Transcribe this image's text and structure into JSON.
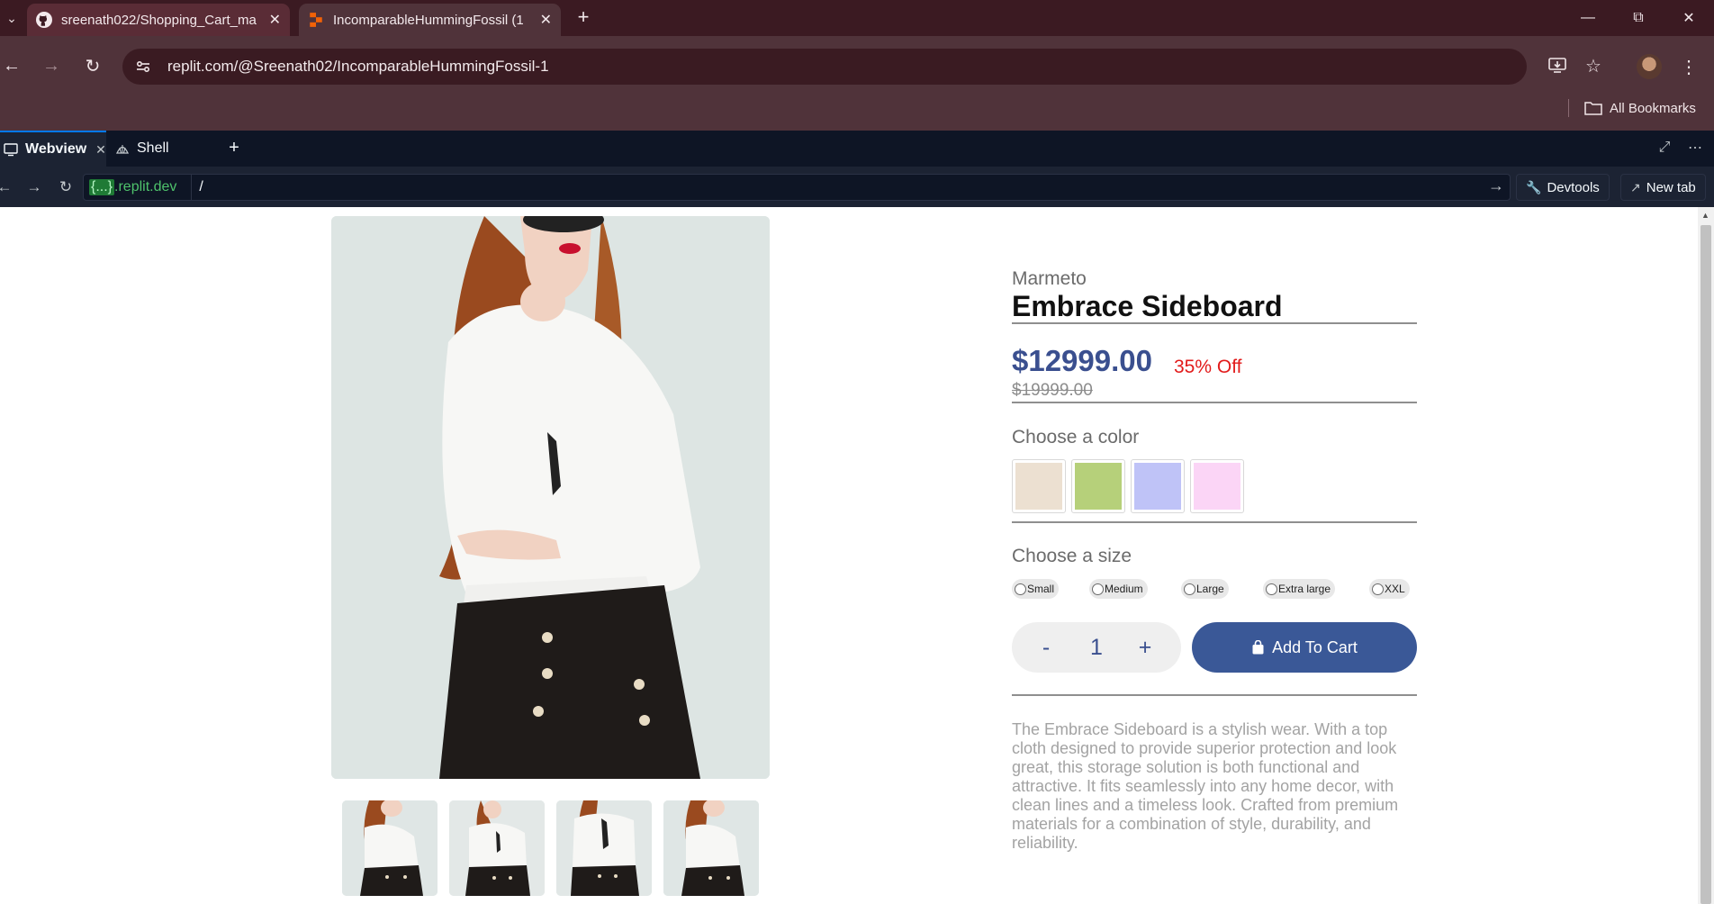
{
  "browser": {
    "tabs": [
      {
        "title": "sreenath022/Shopping_Cart_ma",
        "icon": "github-icon",
        "active": false
      },
      {
        "title": "IncomparableHummingFossil (1",
        "icon": "replit-icon",
        "active": true
      }
    ],
    "url": "replit.com/@Sreenath02/IncomparableHummingFossil-1",
    "bookmarks_label": "All Bookmarks"
  },
  "replit": {
    "tabs": [
      {
        "label": "Webview"
      },
      {
        "label": "Shell"
      }
    ],
    "domain_highlight": "{...}",
    "domain_rest": ".replit.dev",
    "path": "/",
    "devtools_label": "Devtools",
    "newtab_label": "New tab"
  },
  "product": {
    "vendor": "Marmeto",
    "title": "Embrace Sideboard",
    "price": "$12999.00",
    "discount": "35% Off",
    "compare_price": "$19999.00",
    "color_label": "Choose a color",
    "colors": [
      "#ece0d1",
      "#b6d07a",
      "#bfc3f7",
      "#fbd5f6"
    ],
    "size_label": "Choose a size",
    "sizes": [
      "Small",
      "Medium",
      "Large",
      "Extra large",
      "XXL"
    ],
    "quantity": "1",
    "minus": "-",
    "plus": "+",
    "add_to_cart": "Add To Cart",
    "description": "The Embrace Sideboard is a stylish wear. With a top cloth designed to provide superior protection and look great, this storage solution is both functional and attractive. It fits seamlessly into any home decor, with clean lines and a timeless look. Crafted from premium materials for a combination of style, durability, and reliability."
  }
}
